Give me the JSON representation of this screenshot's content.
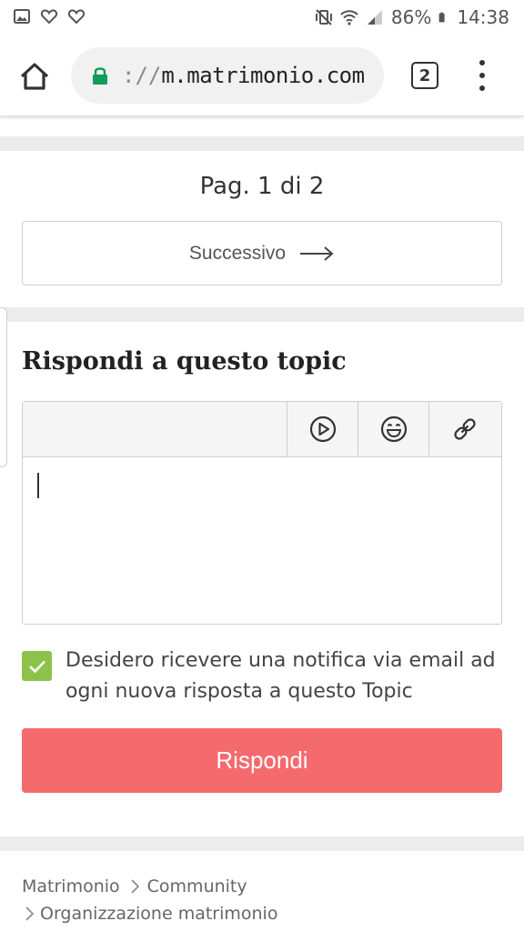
{
  "status_bar": {
    "battery": "86%",
    "time": "14:38",
    "left_icons": [
      "image-icon",
      "heart-outline-icon",
      "heart-outline-icon"
    ],
    "right_icons": [
      "mute-vibrate-icon",
      "wifi-icon",
      "signal-icon",
      "battery-icon"
    ]
  },
  "browser": {
    "url_scheme": "://",
    "url_host": "m.matrimonio.com",
    "tab_count": "2",
    "accent": "#0f9d58"
  },
  "pagination": {
    "label": "Pag. 1 di 2",
    "next_label": "Successivo"
  },
  "reply": {
    "title": "Rispondi a questo topic",
    "toolbar": [
      "video-play-icon",
      "emoji-icon",
      "link-icon"
    ],
    "notify_label": "Desidero ricevere una notifica via email ad ogni nuova risposta a questo Topic",
    "notify_checked": true,
    "submit_label": "Rispondi"
  },
  "breadcrumb": {
    "items": [
      "Matrimonio",
      "Community",
      "Organizzazione matrimonio"
    ]
  },
  "colors": {
    "submit": "#f46a6d",
    "checkbox": "#8dc24a",
    "separator": "#ececec"
  }
}
